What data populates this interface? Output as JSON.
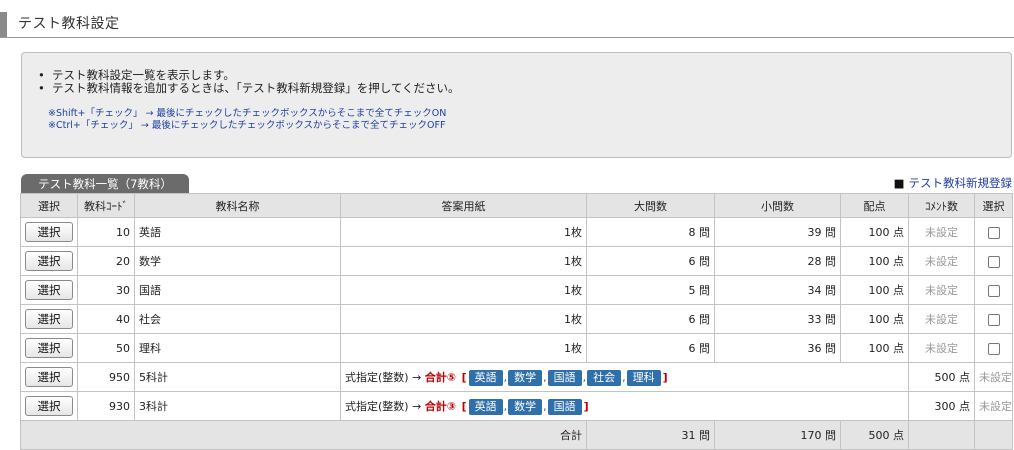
{
  "page": {
    "title": "テスト教科設定"
  },
  "info": {
    "bullets": [
      "テスト教科設定一覧を表示します。",
      "テスト教科情報を追加するときは、「テスト教科新規登録」を押してください。"
    ],
    "notes": [
      "※Shift+「チェック」 → 最後にチェックしたチェックボックスからそこまで全てチェックON",
      "※Ctrl+「チェック」 → 最後にチェックしたチェックボックスからそこまで全てチェックOFF"
    ]
  },
  "tab": {
    "label": "テスト教科一覧（7教科）"
  },
  "register": {
    "marker": "■",
    "label": "テスト教科新規登録"
  },
  "table": {
    "headers": [
      "選択",
      "教科ｺｰﾄﾞ",
      "教科名称",
      "答案用紙",
      "大問数",
      "小問数",
      "配点",
      "ｺﾒﾝﾄ数",
      "選択"
    ],
    "select_label": "選択",
    "rows": [
      {
        "code": "10",
        "name": "英語",
        "sheet": "1枚",
        "large": "8 問",
        "small": "39 問",
        "points": "100 点",
        "comments": "未設定"
      },
      {
        "code": "20",
        "name": "数学",
        "sheet": "1枚",
        "large": "6 問",
        "small": "28 問",
        "points": "100 点",
        "comments": "未設定"
      },
      {
        "code": "30",
        "name": "国語",
        "sheet": "1枚",
        "large": "5 問",
        "small": "34 問",
        "points": "100 点",
        "comments": "未設定"
      },
      {
        "code": "40",
        "name": "社会",
        "sheet": "1枚",
        "large": "6 問",
        "small": "33 問",
        "points": "100 点",
        "comments": "未設定"
      },
      {
        "code": "50",
        "name": "理科",
        "sheet": "1枚",
        "large": "6 問",
        "small": "36 問",
        "points": "100 点",
        "comments": "未設定"
      }
    ],
    "formula_rows": [
      {
        "code": "950",
        "name": "5科計",
        "formula_prefix": "式指定(整数) →",
        "formula_total": "合計⑤",
        "bracket_open": "[",
        "bracket_close": "]",
        "subjects": [
          "英語",
          "数学",
          "国語",
          "社会",
          "理科"
        ],
        "points": "500 点",
        "comments": "未設定"
      },
      {
        "code": "930",
        "name": "3科計",
        "formula_prefix": "式指定(整数) →",
        "formula_total": "合計③",
        "bracket_open": "[",
        "bracket_close": "]",
        "subjects": [
          "英語",
          "数学",
          "国語"
        ],
        "points": "300 点",
        "comments": "未設定"
      }
    ],
    "separator": ",",
    "footer": {
      "label": "合計",
      "large": "31 問",
      "small": "170 問",
      "points": "500 点"
    }
  }
}
